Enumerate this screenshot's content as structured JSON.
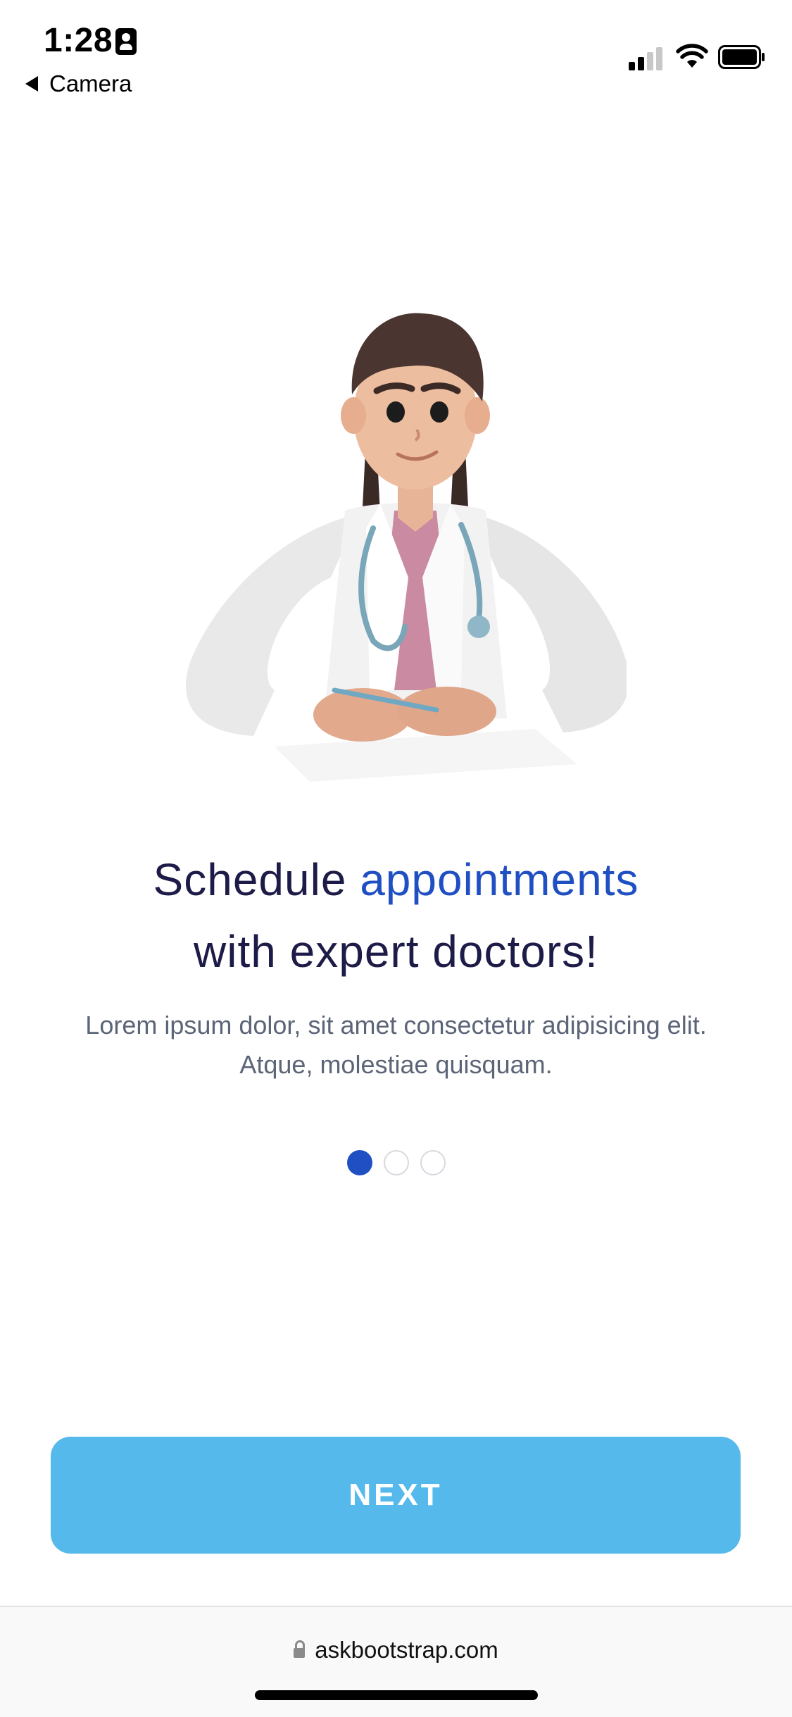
{
  "status_bar": {
    "time": "1:28",
    "back_label": "Camera",
    "icons": [
      "contact-card-icon",
      "cellular-signal-icon",
      "wifi-icon",
      "battery-icon"
    ]
  },
  "illustration": {
    "icon": "doctor-illustration"
  },
  "headline": {
    "line1_prefix": "Schedule",
    "line1_accent": "appointments",
    "line2": "with expert doctors!"
  },
  "description": "Lorem ipsum dolor, sit amet consectetur adipisicing elit. Atque, molestiae quisquam.",
  "pagination": {
    "total": 3,
    "current": 1
  },
  "next_button": {
    "label": "NEXT"
  },
  "browser": {
    "url": "askbootstrap.com"
  },
  "colors": {
    "accent": "#1f4fc2",
    "heading": "#1d1b47",
    "body_text": "#5c6478",
    "button": "#56b9ec"
  }
}
